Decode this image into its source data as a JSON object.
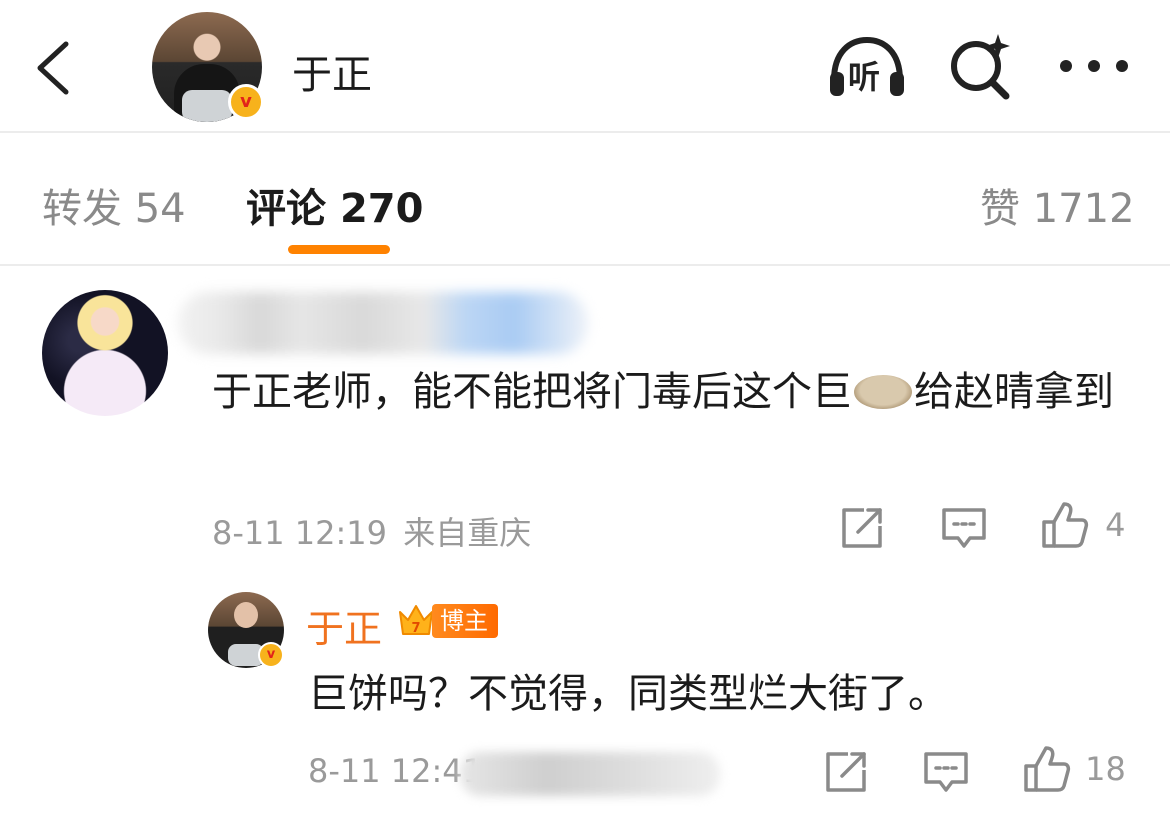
{
  "header": {
    "title": "于正",
    "verified_badge": "v",
    "listen_label": "听",
    "icons": [
      "back-icon",
      "listen-icon",
      "search-icon",
      "more-icon"
    ]
  },
  "tabs": [
    {
      "label": "转发",
      "count": "54"
    },
    {
      "label": "评论",
      "count": "270",
      "active": true
    },
    {
      "label": "赞",
      "count": "1712"
    }
  ],
  "comment": {
    "text_before": "于正老师，能不能把将门毒后这个巨",
    "text_after": "给赵晴拿到",
    "time": "8-11 12:19",
    "location": "来自重庆",
    "like_count": "4"
  },
  "reply": {
    "name": "于正",
    "tag": "博主",
    "crown_level": "7",
    "verified_badge": "v",
    "text": "巨饼吗？不觉得，同类型烂大街了。",
    "time": "8-11 12:41",
    "like_count": "18"
  },
  "colors": {
    "accent": "#ff8200",
    "reply_name": "#f0721f",
    "muted": "#9a9a9a"
  }
}
